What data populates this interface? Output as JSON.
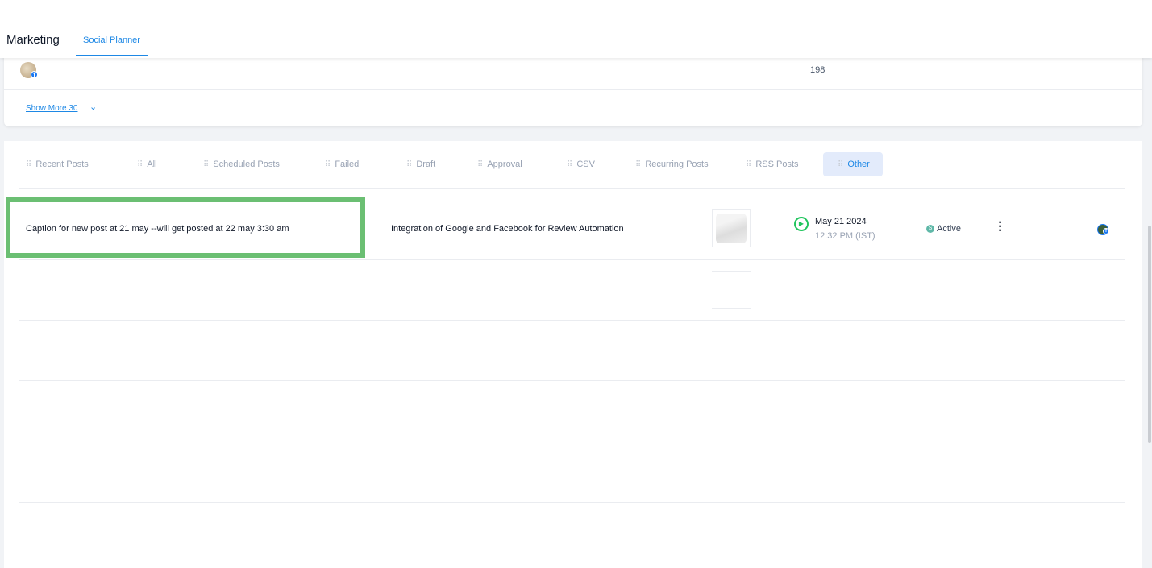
{
  "header": {
    "title": "Marketing",
    "active_tab": "Social Planner"
  },
  "top_card": {
    "count": "198",
    "show_more": "Show More 30",
    "avatar_badge": "f"
  },
  "tabs": [
    "Recent Posts",
    "All",
    "Scheduled Posts",
    "Failed",
    "Draft",
    "Approval",
    "CSV",
    "Recurring Posts",
    "RSS Posts",
    "Other"
  ],
  "active_tab": "Other",
  "post": {
    "caption": "Caption for new post at 21 may --will get posted at 22 may 3:30 am",
    "title": "Integration of Google and Facebook for Review Automation",
    "date": "May 21 2024",
    "time": "12:32 PM (IST)",
    "status": "Active",
    "status_letter": "S",
    "status_color": "#5fb8a8",
    "icons": {
      "play": "play-circle-icon",
      "more": "kebab-menu-icon",
      "account": "facebook-avatar-icon"
    }
  },
  "colors": {
    "accent": "#1e88e5",
    "highlight": "#6bbf73"
  }
}
